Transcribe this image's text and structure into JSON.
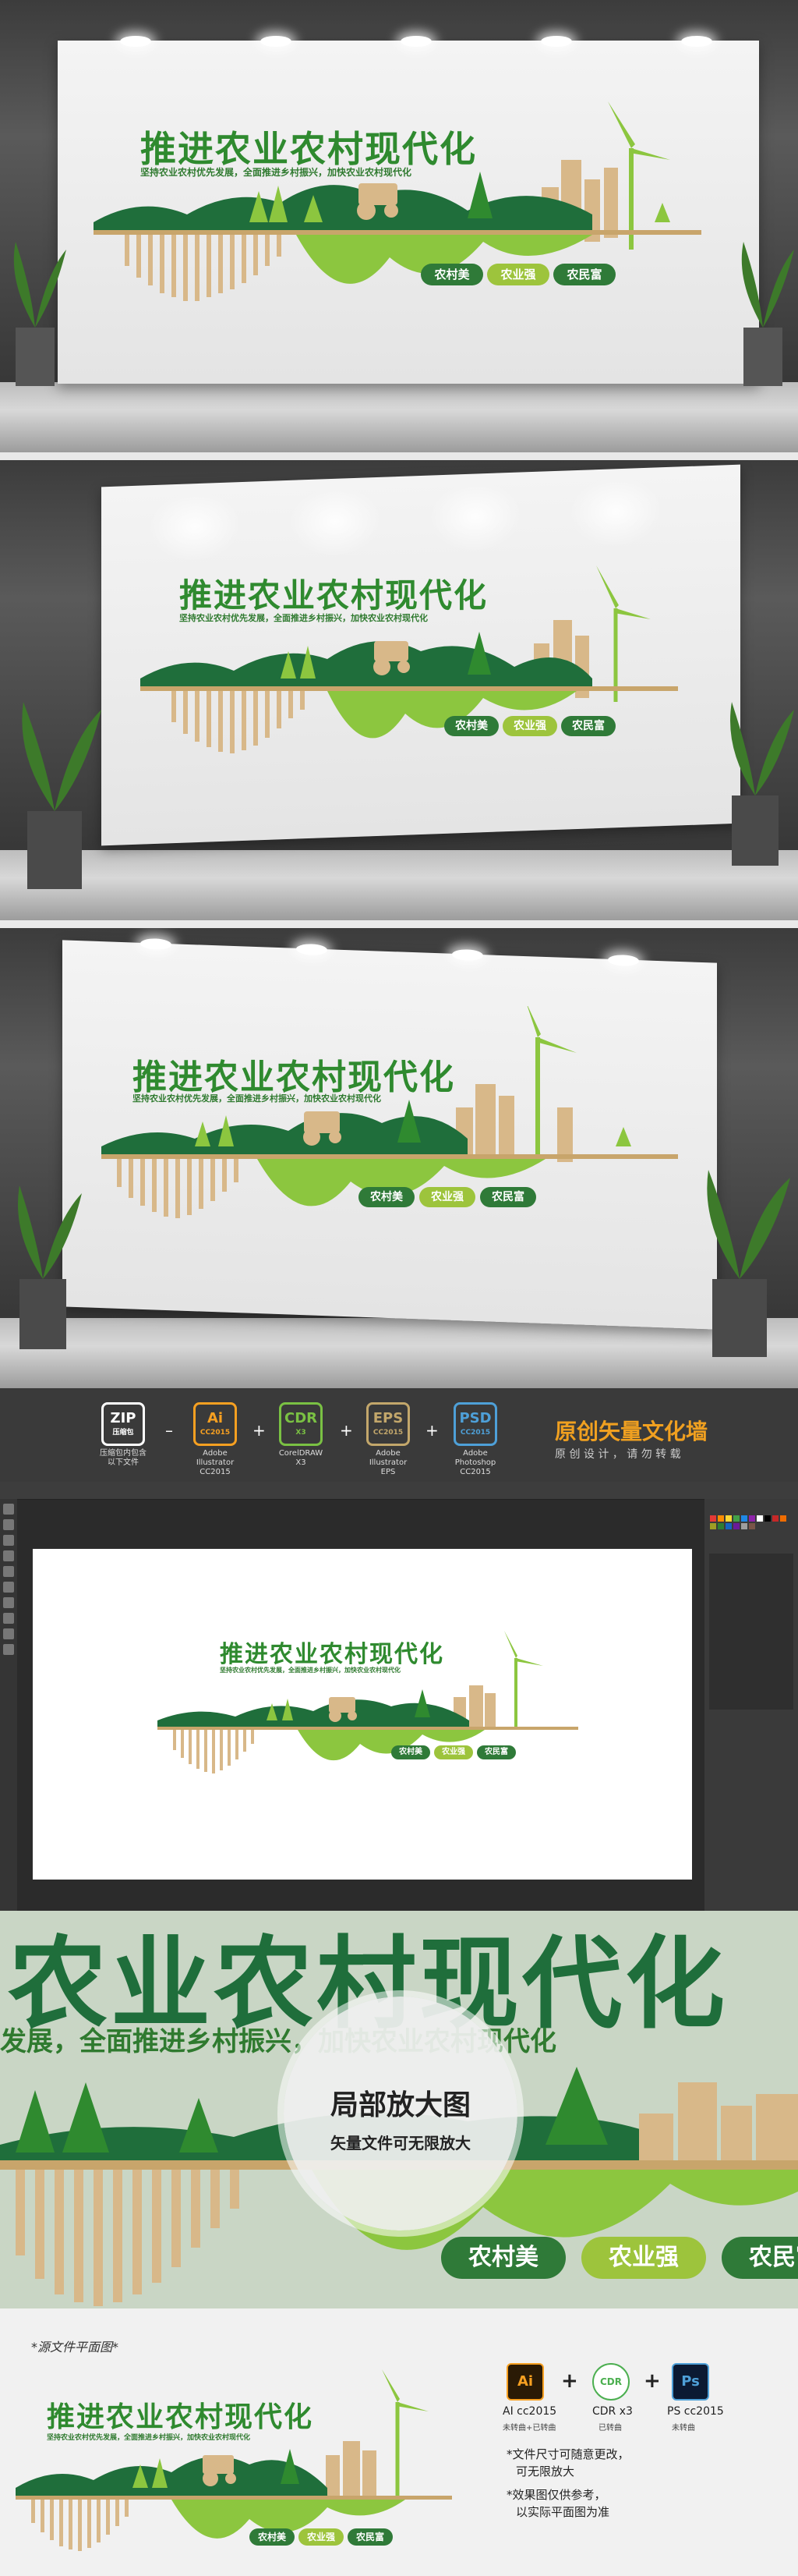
{
  "design": {
    "title": "推进农业农村现代化",
    "subtitle": "坚持农业农村优先发展，全面推进乡村振兴，加快农业农村现代化",
    "tags": [
      "农村美",
      "农业强",
      "农民富"
    ]
  },
  "colors": {
    "dark_green": "#1f6e3b",
    "mid_green": "#2f8a2f",
    "light_green": "#9dc43c",
    "tan": "#d8b889",
    "bar_bg": "#3a3a3a"
  },
  "format_bar": {
    "formats": [
      {
        "code": "ZIP",
        "sub": "压缩包",
        "desc": "压缩包内包含\n以下文件",
        "color": "#ffffff"
      },
      {
        "code": "Ai",
        "sub": "CC2015",
        "desc": "Adobe Illustrator\nCC2015",
        "color": "#f7a021"
      },
      {
        "code": "CDR",
        "sub": "X3",
        "desc": "CorelDRAW\nX3",
        "color": "#7ac143"
      },
      {
        "code": "EPS",
        "sub": "CC2015",
        "desc": "Adobe Illustrator\nEPS",
        "color": "#c3a76b"
      },
      {
        "code": "PSD",
        "sub": "CC2015",
        "desc": "Adobe Photoshop\nCC2015",
        "color": "#4ea0d8"
      }
    ],
    "ops": [
      "–",
      "+",
      "+",
      "+"
    ],
    "brand_title": "原创矢量文化墙",
    "brand_sub": "原 创 设 计 ， 请 勿 转 载"
  },
  "zoom": {
    "big_text": "农业农村现代化",
    "sub_text": "发展，全面推进乡村振兴，加快农业农村现代化",
    "circle_title": "局部放大图",
    "circle_sub": "矢量文件可无限放大"
  },
  "bottom": {
    "label": "*源文件平面图*",
    "apps": [
      {
        "code": "Ai",
        "name": "AI cc2015",
        "note": "未转曲+已转曲",
        "bg": "#2a1a05",
        "fg": "#f7a021"
      },
      {
        "code": "CDR",
        "name": "CDR x3",
        "note": "已转曲",
        "bg": "#ffffff",
        "fg": "#4caf50"
      },
      {
        "code": "Ps",
        "name": "PS cc2015",
        "note": "未转曲",
        "bg": "#0b1a33",
        "fg": "#4ea0d8"
      }
    ],
    "plus": "+",
    "notes": [
      "*文件尺寸可随意更改，",
      "可无限放大",
      "*效果图仅供参考，",
      "以实际平面图为准"
    ]
  }
}
